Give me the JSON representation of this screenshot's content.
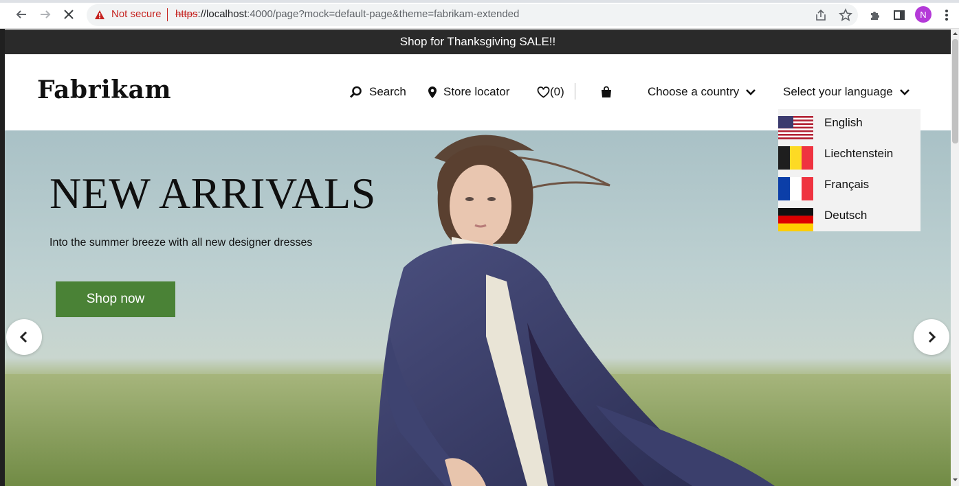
{
  "browser": {
    "security_label": "Not secure",
    "url_scheme": "https",
    "url_host": "://localhost",
    "url_rest": ":4000/page?mock=default-page&theme=fabrikam-extended",
    "profile_initial": "N"
  },
  "promo": {
    "text": "Shop for Thanksgiving SALE!!"
  },
  "header": {
    "logo": "Fabrikam",
    "search_label": "Search",
    "store_locator_label": "Store locator",
    "wishlist_count": "(0)",
    "country_label": "Choose a country",
    "language_label": "Select your language"
  },
  "language_menu": {
    "items": [
      {
        "label": "English",
        "flag": "us-flag-icon"
      },
      {
        "label": "Liechtenstein",
        "flag": "belgium-flag-icon"
      },
      {
        "label": "Français",
        "flag": "france-flag-icon"
      },
      {
        "label": "Deutsch",
        "flag": "germany-flag-icon"
      }
    ]
  },
  "hero": {
    "title": "NEW ARRIVALS",
    "subtitle": "Into the summer breeze with all new designer dresses",
    "cta_label": "Shop now"
  },
  "colors": {
    "promo_bg": "#2a2a2a",
    "cta_bg": "#4a8236",
    "menu_bg": "#f2f2f2",
    "insecure_red": "#c5221f",
    "profile_purple": "#b43ad8"
  }
}
